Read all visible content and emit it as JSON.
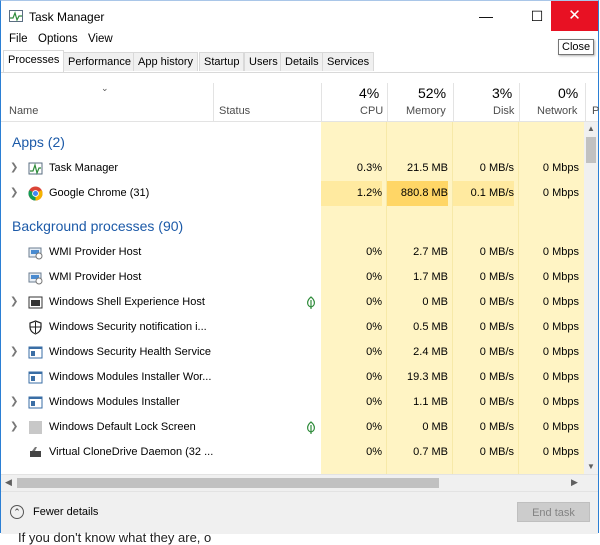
{
  "window": {
    "title": "Task Manager"
  },
  "tooltip": "Close",
  "menu": [
    "File",
    "Options",
    "View"
  ],
  "tabs": [
    "Processes",
    "Performance",
    "App history",
    "Startup",
    "Users",
    "Details",
    "Services"
  ],
  "active_tab": "Processes",
  "header": {
    "name": "Name",
    "status": "Status",
    "cpu": {
      "pct": "4%",
      "label": "CPU"
    },
    "memory": {
      "pct": "52%",
      "label": "Memory"
    },
    "disk": {
      "pct": "3%",
      "label": "Disk"
    },
    "network": {
      "pct": "0%",
      "label": "Network"
    },
    "power": "P"
  },
  "groups": {
    "apps": "Apps (2)",
    "background": "Background processes (90)"
  },
  "apps": [
    {
      "name": "Task Manager",
      "icon": "task-manager-icon",
      "cpu": "0.3%",
      "memory": "21.5 MB",
      "disk": "0 MB/s",
      "network": "0 Mbps"
    },
    {
      "name": "Google Chrome (31)",
      "icon": "chrome-icon",
      "cpu": "1.2%",
      "memory": "880.8 MB",
      "disk": "0.1 MB/s",
      "network": "0 Mbps"
    }
  ],
  "background": [
    {
      "name": "WMI Provider Host",
      "icon": "wmi-icon",
      "cpu": "0%",
      "memory": "2.7 MB",
      "disk": "0 MB/s",
      "network": "0 Mbps"
    },
    {
      "name": "WMI Provider Host",
      "icon": "wmi-icon",
      "cpu": "0%",
      "memory": "1.7 MB",
      "disk": "0 MB/s",
      "network": "0 Mbps"
    },
    {
      "name": "Windows Shell Experience Host",
      "icon": "window-app-icon",
      "cpu": "0%",
      "memory": "0 MB",
      "disk": "0 MB/s",
      "network": "0 Mbps"
    },
    {
      "name": "Windows Security notification i...",
      "icon": "shield-icon",
      "cpu": "0%",
      "memory": "0.5 MB",
      "disk": "0 MB/s",
      "network": "0 Mbps"
    },
    {
      "name": "Windows Security Health Service",
      "icon": "window-app-icon",
      "cpu": "0%",
      "memory": "2.4 MB",
      "disk": "0 MB/s",
      "network": "0 Mbps"
    },
    {
      "name": "Windows Modules Installer Wor...",
      "icon": "window-app-icon",
      "cpu": "0%",
      "memory": "19.3 MB",
      "disk": "0 MB/s",
      "network": "0 Mbps"
    },
    {
      "name": "Windows Modules Installer",
      "icon": "window-app-icon",
      "cpu": "0%",
      "memory": "1.1 MB",
      "disk": "0 MB/s",
      "network": "0 Mbps"
    },
    {
      "name": "Windows Default Lock Screen",
      "icon": "lock-screen-icon",
      "cpu": "0%",
      "memory": "0 MB",
      "disk": "0 MB/s",
      "network": "0 Mbps"
    },
    {
      "name": "Virtual CloneDrive Daemon (32 ...",
      "icon": "disc-drive-icon",
      "cpu": "0%",
      "memory": "0.7 MB",
      "disk": "0 MB/s",
      "network": "0 Mbps"
    }
  ],
  "footer": {
    "fewer_details": "Fewer details",
    "end_task": "End task"
  },
  "background_text": "If you don't know what they are, o",
  "colors": {
    "heat_light": "#fff4c4",
    "heat_hot": "#ffd666",
    "heat_warm": "#ffeaa0",
    "group_title": "#1c5aa8",
    "close_red": "#e81123"
  }
}
